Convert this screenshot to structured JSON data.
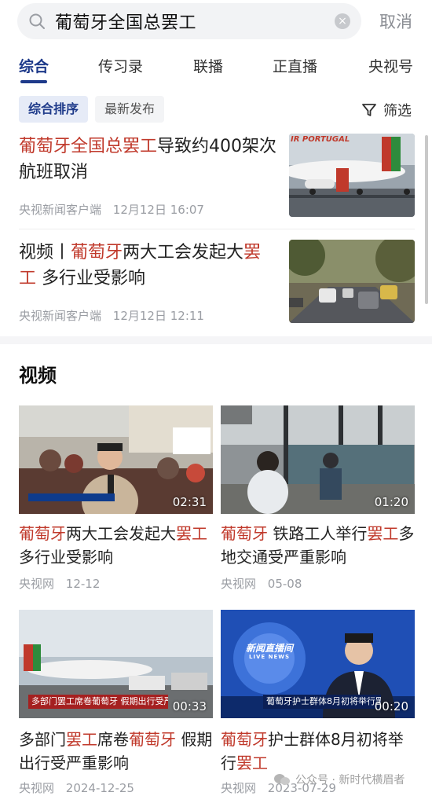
{
  "search": {
    "query": "葡萄牙全国总罢工",
    "cancel_label": "取消"
  },
  "tabs": [
    {
      "label": "综合",
      "active": true
    },
    {
      "label": "传习录"
    },
    {
      "label": "联播"
    },
    {
      "label": "正直播"
    },
    {
      "label": "央视号"
    }
  ],
  "sort": {
    "options": [
      "综合排序",
      "最新发布"
    ],
    "selected": "综合排序",
    "filter_label": "筛选"
  },
  "news": [
    {
      "title_parts": [
        {
          "text": "葡萄牙全国总罢工",
          "hl": true
        },
        {
          "text": "导致约400架次航班取消",
          "hl": false
        }
      ],
      "source": "央视新闻客户端",
      "time": "12月12日 16:07",
      "thumb_caption": "IR PORTUGAL"
    },
    {
      "title_parts": [
        {
          "text": "视频丨",
          "hl": false
        },
        {
          "text": "葡萄牙",
          "hl": true
        },
        {
          "text": "两大工会发起大",
          "hl": false
        },
        {
          "text": "罢工",
          "hl": true
        },
        {
          "text": " 多行业受影响",
          "hl": false
        }
      ],
      "source": "央视新闻客户端",
      "time": "12月12日 12:11"
    }
  ],
  "video_section": {
    "title": "视频",
    "videos": [
      {
        "duration": "02:31",
        "title_parts": [
          {
            "text": "葡萄牙",
            "hl": true
          },
          {
            "text": "两大工会发起大",
            "hl": false
          },
          {
            "text": "罢工",
            "hl": true
          },
          {
            "text": " 多行业受影响",
            "hl": false
          }
        ],
        "source": "央视网",
        "date": "12-12"
      },
      {
        "duration": "01:20",
        "title_parts": [
          {
            "text": "葡萄牙",
            "hl": true
          },
          {
            "text": " 铁路工人举行",
            "hl": false
          },
          {
            "text": "罢工",
            "hl": true
          },
          {
            "text": "多地交通受严重影响",
            "hl": false
          }
        ],
        "source": "央视网",
        "date": "05-08"
      },
      {
        "duration": "00:33",
        "overlay_text": "多部门罢工席卷葡萄牙 假期出行受严重影响",
        "title_parts": [
          {
            "text": "多部门",
            "hl": false
          },
          {
            "text": "罢工",
            "hl": true
          },
          {
            "text": "席卷",
            "hl": false
          },
          {
            "text": "葡萄牙",
            "hl": true
          },
          {
            "text": " 假期出行受严重影响",
            "hl": false
          }
        ],
        "source": "央视网",
        "date": "2024-12-25"
      },
      {
        "duration": "00:20",
        "overlay_text": "葡萄牙护士群体8月初将举行罢",
        "logo_text": "新闻直播间",
        "logo_sub": "LIVE NEWS",
        "title_parts": [
          {
            "text": "葡萄牙",
            "hl": true
          },
          {
            "text": "护士群体8月初将举行",
            "hl": false
          },
          {
            "text": "罢工",
            "hl": true
          }
        ],
        "source": "央视网",
        "date": "2023-07-29"
      }
    ]
  },
  "watermark": "公众号 · 新时代横眉者",
  "colors": {
    "accent": "#1e3a8a",
    "highlight": "#c0392b",
    "meta": "#9a9da3"
  }
}
